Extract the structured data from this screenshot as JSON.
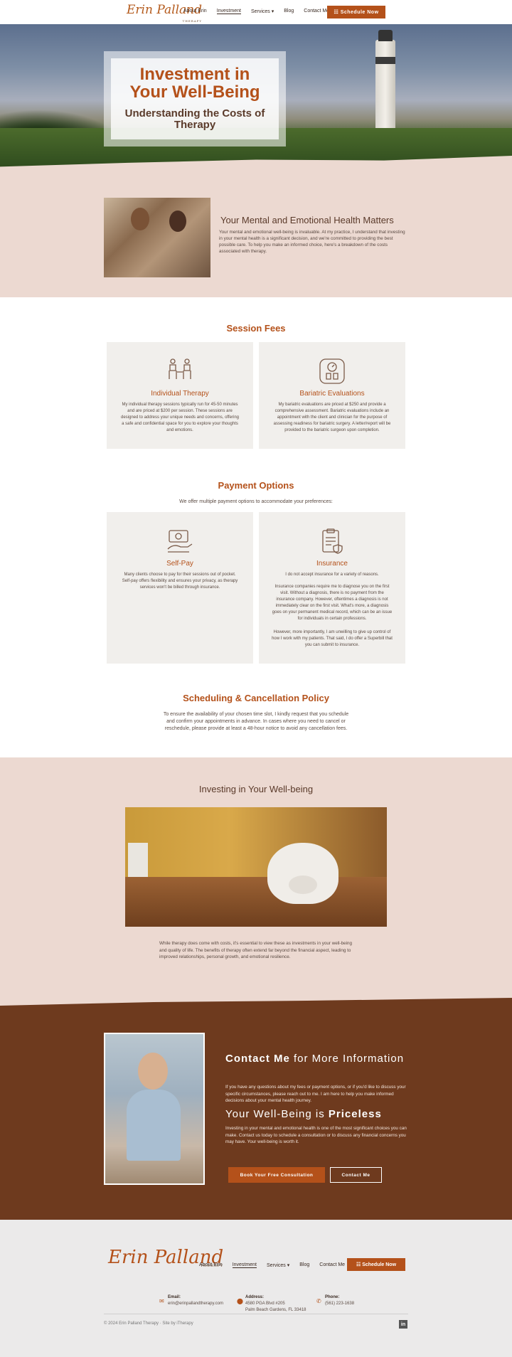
{
  "header": {
    "logo_text": "Erin Palland",
    "logo_sub": "THERAPY",
    "nav": [
      "About Erin",
      "Investment",
      "Services ▾",
      "Blog",
      "Contact Me"
    ],
    "cta": "☷ Schedule Now"
  },
  "hero": {
    "title_line1": "Investment in",
    "title_line2": "Your Well-Being",
    "subtitle_line1": "Understanding the Costs of",
    "subtitle_line2": "Therapy"
  },
  "intro": {
    "heading": "Your Mental and Emotional Health Matters",
    "body": "Your mental and emotional well-being is invaluable. At my practice, I understand that investing in your mental health is a significant decision, and we're committed to providing the best possible care. To help you make an informed choice, here's a breakdown of the costs associated with therapy."
  },
  "fees": {
    "title": "Session Fees",
    "cards": [
      {
        "title": "Individual Therapy",
        "body": "My individual therapy sessions typically run for 45-50 minutes and are priced at $200 per session. These sessions are designed to address your unique needs and concerns, offering a safe and confidential space for you to explore your thoughts and emotions."
      },
      {
        "title": "Bariatric Evaluations",
        "body": "My bariatric evaluations are priced at $250 and provide a comprehensive assessment. Bariatric evaluations include an appointment with the client and clinician for the purpose of assessing readiness for bariatric surgery. A letter/report will be provided to the bariatric surgeon upon completion."
      }
    ]
  },
  "payment": {
    "title": "Payment Options",
    "subtitle": "We offer multiple payment options to accommodate your preferences:",
    "cards": [
      {
        "title": "Self-Pay",
        "body": "Many clients choose to pay for their sessions out of pocket. Self-pay offers flexibility and ensures your privacy, as therapy services won't be billed through insurance."
      },
      {
        "title": "Insurance",
        "body1": "I do not accept insurance for a variety of reasons.",
        "body2": "Insurance companies require me to diagnose you on the first visit. Without a diagnosis, there is no payment from the insurance company. However, oftentimes a diagnosis is not immediately clear on the first visit. What's more, a diagnosis goes on your permanent medical record, which can be an issue for individuals in certain professions.",
        "body3": "However, more importantly, I am unwilling to give up control of how I work with my patients. That said, I do offer a Superbill that you can submit to insurance."
      }
    ]
  },
  "schedule": {
    "title": "Scheduling & Cancellation Policy",
    "body": "To ensure the availability of your chosen time slot, I kindly request that you schedule and confirm your appointments in advance. In cases where you need to cancel or reschedule, please provide at least a 48-hour notice to avoid any cancellation fees."
  },
  "invest": {
    "title": "Investing in Your Well-being",
    "body": "While therapy does come with costs, it's essential to view these as investments in your well-being and quality of life. The benefits of therapy often extend far beyond the financial aspect, leading to improved relationships, personal growth, and emotional resilience."
  },
  "contact": {
    "title_bold": "Contact Me",
    "title_rest": " for More Information",
    "body1": "If you have any questions about my fees or payment options, or if you'd like to discuss your specific circumstances, please reach out to me. I am here to help you make informed decisions about your mental health journey.",
    "title2_a": "Your Well-Being is ",
    "title2_b": "Priceless",
    "body2": "Investing in your mental and emotional health is one of the most significant choices you can make. Contact us today to schedule a consultation or to discuss any financial concerns you may have. Your well-being is worth it.",
    "btn_primary": "Book Your Free Consultation",
    "btn_secondary": "Contact Me"
  },
  "footer": {
    "logo_text": "Erin Palland",
    "logo_sub": "THERAPY",
    "nav": [
      "About Erin",
      "Investment",
      "Services ▾",
      "Blog",
      "Contact Me"
    ],
    "cta": "☷ Schedule Now",
    "email_label": "Email:",
    "email": "erin@erinpallandtherapy.com",
    "address_label": "Address:",
    "address1": "4580 PGA Blvd #205",
    "address2": "Palm Beach Gardens, FL 33418",
    "phone_label": "Phone:",
    "phone": "(561) 223-1638",
    "copyright": "© 2024 Erin Palland Therapy · Site by iTherapy",
    "social": "in"
  }
}
